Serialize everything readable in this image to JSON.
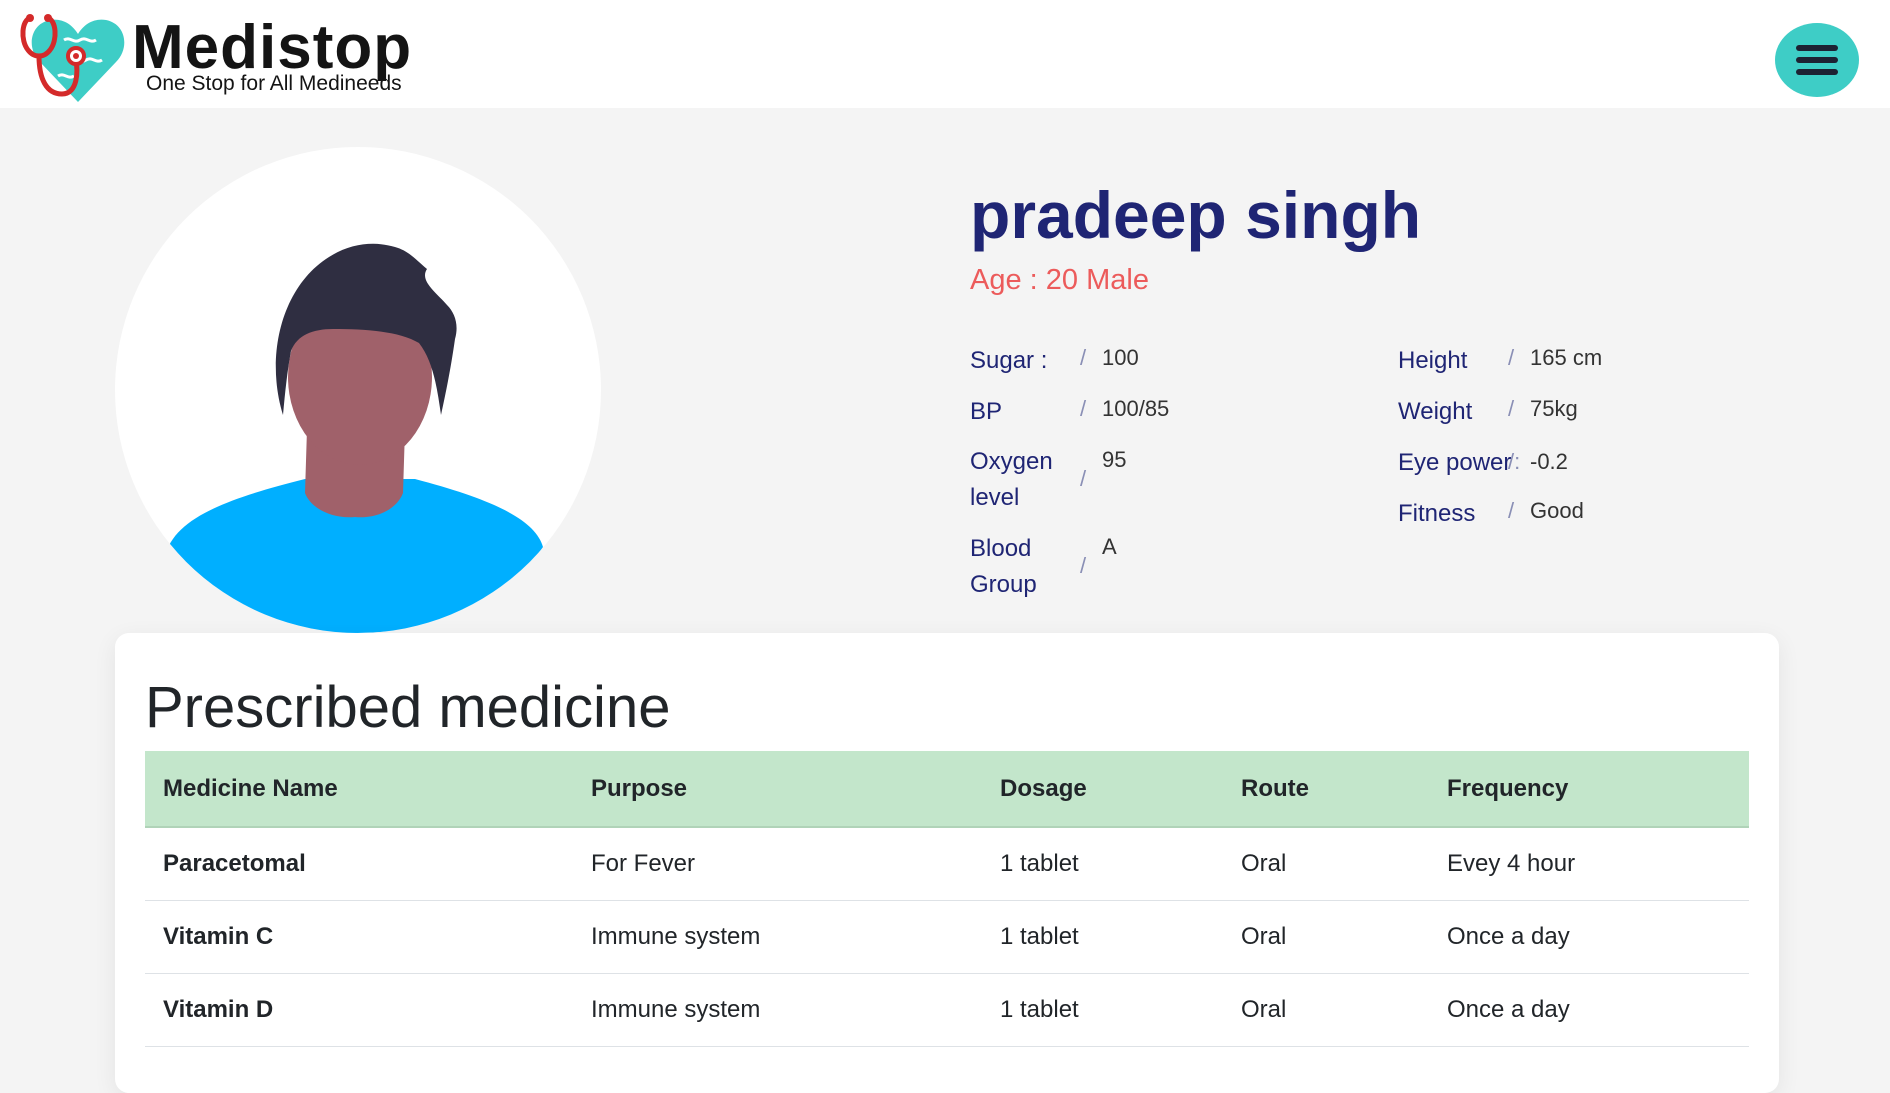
{
  "brand": {
    "name": "Medistop",
    "tagline": "One Stop for All Medineeds"
  },
  "menu": {
    "icon": "hamburger-menu-icon"
  },
  "patient": {
    "name": "pradeep singh",
    "age_label": "Age :",
    "age": "20",
    "gender": "Male",
    "avatar_icon": "person-avatar-icon"
  },
  "stats_left": [
    {
      "label": "Sugar :",
      "sep": "/",
      "value": "100"
    },
    {
      "label": "BP",
      "sep": "/",
      "value": "100/85"
    },
    {
      "label": "Oxygen level",
      "sep": "/",
      "value": "95"
    },
    {
      "label": "Blood Group",
      "sep": "/",
      "value": "A"
    }
  ],
  "stats_right": [
    {
      "label": "Height",
      "sep": "/",
      "value": "165 cm"
    },
    {
      "label": "Weight",
      "sep": "/",
      "value": "75kg"
    },
    {
      "label": "Eye power",
      "sep": "/:",
      "value": "-0.2"
    },
    {
      "label": "Fitness",
      "sep": "/",
      "value": "Good"
    }
  ],
  "prescription": {
    "title": "Prescribed medicine",
    "columns": [
      "Medicine Name",
      "Purpose",
      "Dosage",
      "Route",
      "Frequency"
    ],
    "rows": [
      [
        "Paracetomal",
        "For Fever",
        "1 tablet",
        "Oral",
        "Evey 4 hour"
      ],
      [
        "Vitamin C",
        "Immune system",
        "1 tablet",
        "Oral",
        "Once a day"
      ],
      [
        "Vitamin D",
        "Immune system",
        "1 tablet",
        "Oral",
        "Once a day"
      ]
    ]
  },
  "colors": {
    "accent": "#3ecdc6",
    "name_color": "#1f2574",
    "age_color": "#ec5b5b",
    "table_header_bg": "#c3e6cb"
  }
}
